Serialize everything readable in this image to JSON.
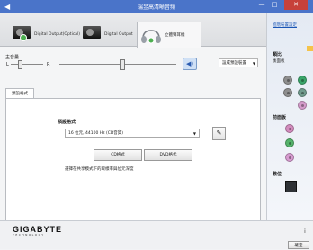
{
  "window": {
    "title": "瑞昱高清晰音頻",
    "icon": "speaker-icon",
    "minimize": "—",
    "maximize": "□",
    "close": "✕"
  },
  "device_tabs": [
    {
      "label": "Digital Output(Optical)",
      "icon": "speaker-box-icon"
    },
    {
      "label": "Digital Output",
      "icon": "speaker-box-icon"
    },
    {
      "label": "立體聲耳機",
      "icon": "headphone-icon",
      "selected": true
    }
  ],
  "volume": {
    "label": "主音量",
    "left_label": "L",
    "right_label": "R",
    "mute_icon": "speaker-volume-icon",
    "default_device_select": "設成預設裝置",
    "balance_level": 0.45,
    "volume_level": 0.55
  },
  "settings": {
    "subtab": "預設格式",
    "format_label": "預設格式",
    "format_value": "16 位元, 44100 Hz (CD音質)",
    "edit_icon": "edit-icon",
    "cd_button": "CD格式",
    "dvd_button": "DVD格式",
    "hint": "選擇在共享模式下的取樣率與位元深度"
  },
  "right_panel": {
    "advanced_link": "進階裝置設定",
    "output_title": "類比",
    "output_sub": "後面板",
    "front_title": "前面板",
    "digital_title": "數位",
    "jack_colors_rear": [
      "#8e8e8e",
      "#3aa56a",
      "#8e8e8e",
      "#6f9a8c",
      "#c58ab6",
      "#d59bcb"
    ],
    "jack_colors_front": [
      "#d28bbd",
      "#55b36b",
      "#d79bd0"
    ]
  },
  "footer": {
    "brand": "GIGABYTE",
    "tagline": "TECHNOLOGY",
    "ok_button": "確定",
    "info_icon": "i"
  }
}
